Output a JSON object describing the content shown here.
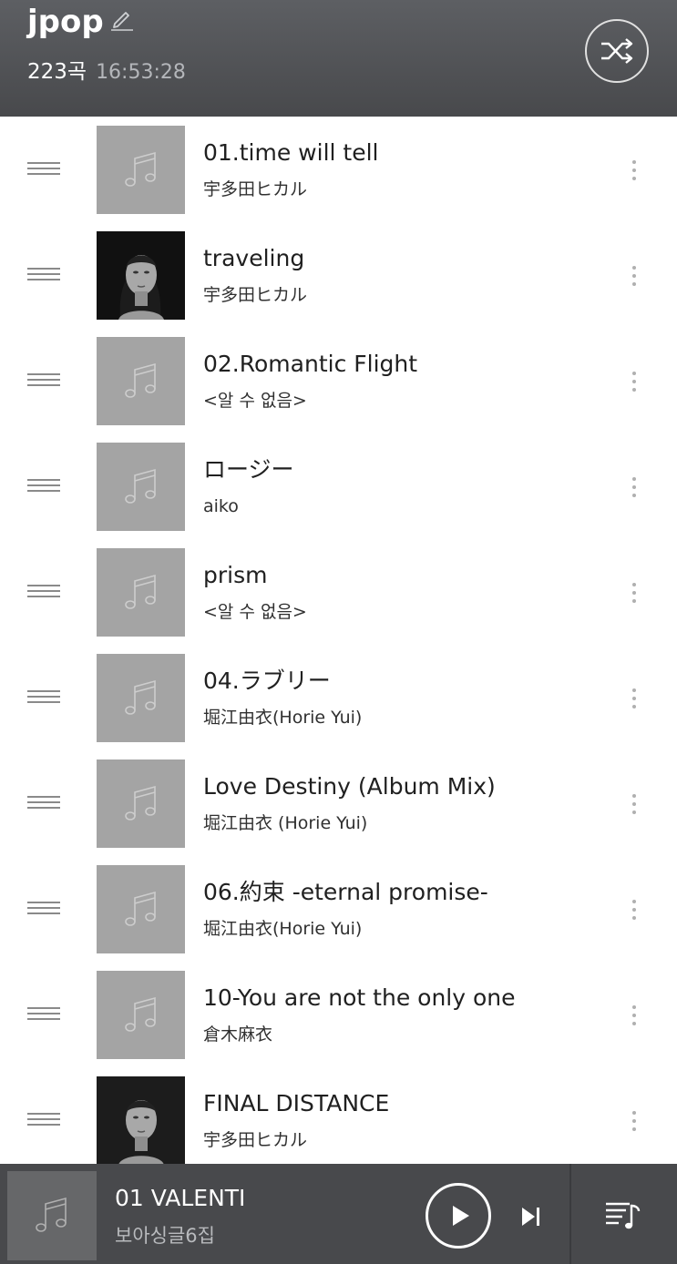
{
  "header": {
    "playlist_title": "jpop",
    "track_count": "223곡",
    "total_duration": "16:53:28"
  },
  "tracks": [
    {
      "title": "01.time will tell",
      "artist": "宇多田ヒカル",
      "art": "placeholder-note"
    },
    {
      "title": "traveling",
      "artist": "宇多田ヒカル",
      "art": "album-photo"
    },
    {
      "title": "02.Romantic Flight",
      "artist": "<알 수 없음>",
      "art": "placeholder-note"
    },
    {
      "title": "ロージー",
      "artist": "aiko",
      "art": "placeholder-note"
    },
    {
      "title": "prism",
      "artist": "<알 수 없음>",
      "art": "placeholder-note"
    },
    {
      "title": "04.ラブリー",
      "artist": "堀江由衣(Horie Yui)",
      "art": "placeholder-note"
    },
    {
      "title": "Love Destiny (Album Mix)",
      "artist": "堀江由衣 (Horie Yui)",
      "art": "placeholder-note"
    },
    {
      "title": "06.約束 -eternal promise-",
      "artist": "堀江由衣(Horie Yui)",
      "art": "placeholder-note"
    },
    {
      "title": "10-You are not the only one",
      "artist": "倉木麻衣",
      "art": "placeholder-note"
    },
    {
      "title": "FINAL DISTANCE",
      "artist": "宇多田ヒカル",
      "art": "album-photo"
    }
  ],
  "player": {
    "title": "01 VALENTI",
    "artist": "보아싱글6집"
  },
  "icons": {
    "edit": "pencil-icon",
    "shuffle": "shuffle-icon",
    "drag": "drag-handle-icon",
    "more": "more-vert-icon",
    "play": "play-icon",
    "next": "skip-next-icon",
    "queue": "queue-music-icon"
  },
  "colors": {
    "header_bg": "#4f5054",
    "player_bg": "#48494c",
    "placeholder_art": "#a4a4a4"
  }
}
